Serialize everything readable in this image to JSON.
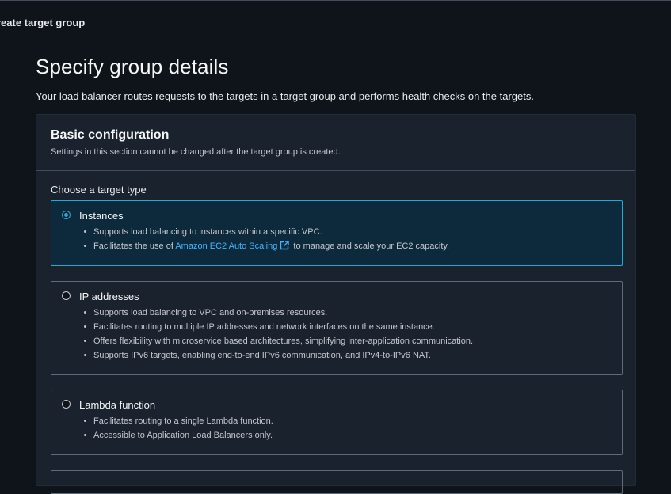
{
  "breadcrumb": {
    "current": "reate target group"
  },
  "page": {
    "title": "Specify group details",
    "description": "Your load balancer routes requests to the targets in a target group and performs health checks on the targets."
  },
  "basic_config": {
    "title": "Basic configuration",
    "subtitle": "Settings in this section cannot be changed after the target group is created.",
    "target_type_label": "Choose a target type",
    "options": [
      {
        "label": "Instances",
        "selected": true,
        "bullets": [
          "Supports load balancing to instances within a specific VPC.",
          {
            "prefix": "Facilitates the use of ",
            "link": "Amazon EC2 Auto Scaling",
            "suffix": " to manage and scale your EC2 capacity."
          }
        ]
      },
      {
        "label": "IP addresses",
        "selected": false,
        "bullets": [
          "Supports load balancing to VPC and on-premises resources.",
          "Facilitates routing to multiple IP addresses and network interfaces on the same instance.",
          "Offers flexibility with microservice based architectures, simplifying inter-application communication.",
          "Supports IPv6 targets, enabling end-to-end IPv6 communication, and IPv4-to-IPv6 NAT."
        ]
      },
      {
        "label": "Lambda function",
        "selected": false,
        "bullets": [
          "Facilitates routing to a single Lambda function.",
          "Accessible to Application Load Balancers only."
        ]
      }
    ]
  },
  "icons": {
    "external_link": "external-link-icon"
  },
  "colors": {
    "accent": "#1dacd9",
    "link": "#42b4ff",
    "background": "#0f141a",
    "panel": "#1a222e"
  }
}
